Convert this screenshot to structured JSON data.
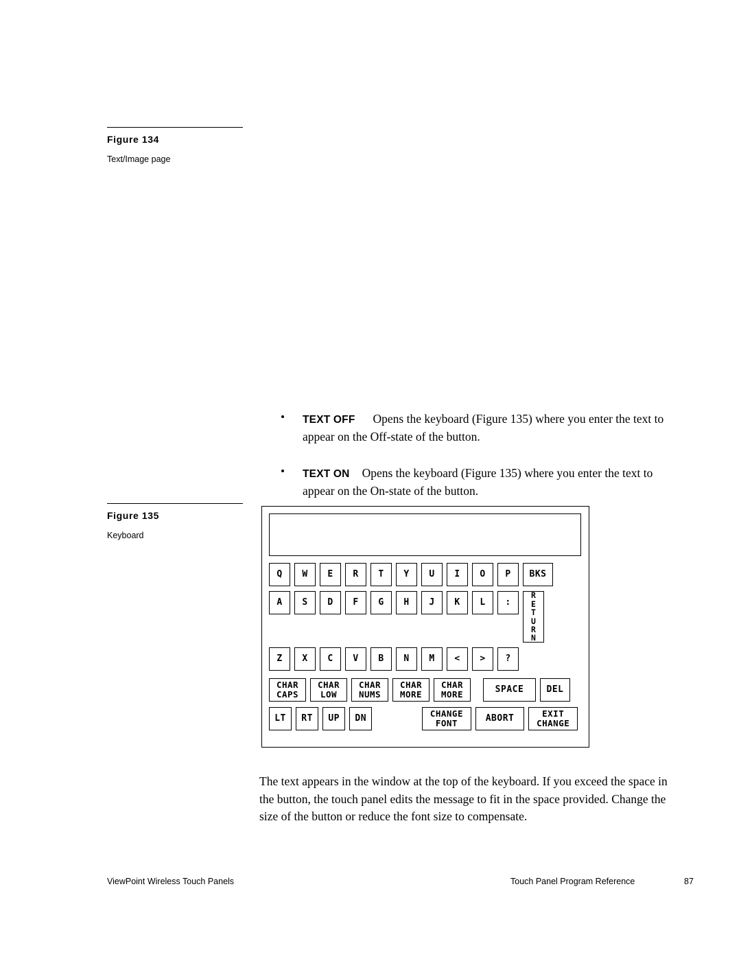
{
  "figures": [
    {
      "title": "Figure  134",
      "caption": "Text/Image page"
    },
    {
      "title": "Figure  135",
      "caption": "Keyboard"
    }
  ],
  "bullets": [
    {
      "label": "TEXT OFF",
      "text_line1": "Opens the keyboard (Figure 135) where you enter the text to",
      "text_line2": "appear on the Off-state of the button."
    },
    {
      "label": "TEXT ON",
      "text_line1": "Opens the keyboard (Figure 135) where you enter the text to",
      "text_line2": "appear on the On-state of the button."
    }
  ],
  "keyboard": {
    "display_value": "",
    "rows": {
      "row1": [
        "Q",
        "W",
        "E",
        "R",
        "T",
        "Y",
        "U",
        "I",
        "O",
        "P",
        "BKS"
      ],
      "row2": [
        "A",
        "S",
        "D",
        "F",
        "G",
        "H",
        "J",
        "K",
        "L",
        ":"
      ],
      "row2_tall": "RETURN",
      "row3": [
        "Z",
        "X",
        "C",
        "V",
        "B",
        "N",
        "M",
        "<",
        ">",
        "?"
      ],
      "row4": [
        {
          "l1": "CHAR",
          "l2": "CAPS"
        },
        {
          "l1": "CHAR",
          "l2": "LOW"
        },
        {
          "l1": "CHAR",
          "l2": "NUMS"
        },
        {
          "l1": "CHAR",
          "l2": "MORE"
        },
        {
          "l1": "CHAR",
          "l2": "MORE"
        }
      ],
      "row4_space": "SPACE",
      "row4_del": "DEL",
      "row5": [
        "LT",
        "RT",
        "UP",
        "DN"
      ],
      "row5_change_font": {
        "l1": "CHANGE",
        "l2": "FONT"
      },
      "row5_abort": "ABORT",
      "row5_exit_change": {
        "l1": "EXIT",
        "l2": "CHANGE"
      }
    }
  },
  "paragraph": {
    "line1": "The text appears in the window at the top of the keyboard. If you exceed the space in",
    "line2": "the button, the touch panel edits the message to fit in the space provided. Change the",
    "line3": "size of the button or reduce the font size to compensate."
  },
  "footer": {
    "left": "ViewPoint Wireless Touch Panels",
    "right": "Touch Panel Program Reference",
    "page": "87"
  }
}
